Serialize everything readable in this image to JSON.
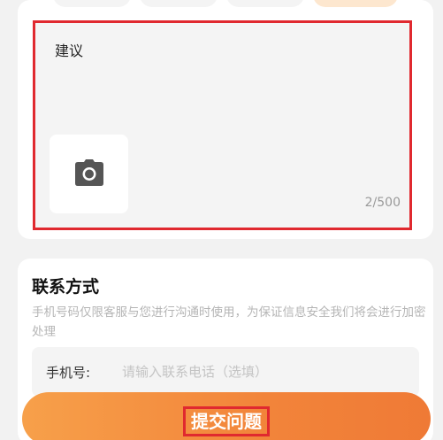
{
  "feedback": {
    "text": "建议",
    "counter": "2/500",
    "photo_icon": "camera-icon"
  },
  "contact": {
    "title": "联系方式",
    "description": "手机号码仅限客服与您进行沟通时使用，为保证信息安全我们将会进行加密处理",
    "phone_label": "手机号:",
    "phone_placeholder": "请输入联系电话（选填）",
    "phone_value": ""
  },
  "submit": {
    "label": "提交问题"
  },
  "colors": {
    "highlight_border": "#e0292f",
    "submit_gradient_start": "#f7a04a",
    "submit_gradient_end": "#ef7a36"
  }
}
